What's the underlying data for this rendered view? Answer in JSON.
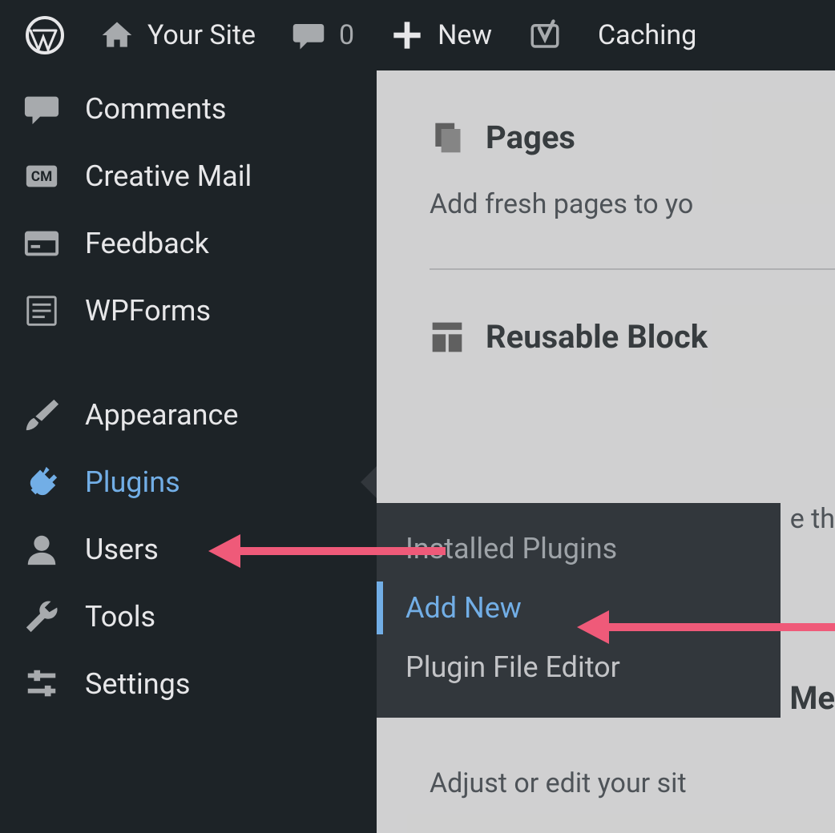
{
  "adminbar": {
    "site_name": "Your Site",
    "comment_count": "0",
    "new_label": "New",
    "caching_label": "Caching"
  },
  "sidebar": {
    "comments": "Comments",
    "creative_mail": "Creative Mail",
    "feedback": "Feedback",
    "wpforms": "WPForms",
    "appearance": "Appearance",
    "plugins": "Plugins",
    "users": "Users",
    "tools": "Tools",
    "settings": "Settings"
  },
  "submenu": {
    "installed": "Installed Plugins",
    "add_new": "Add New",
    "file_editor": "Plugin File Editor"
  },
  "content": {
    "pages_heading": "Pages",
    "pages_text": "Add fresh pages to yo",
    "blocks_heading": "Reusable Block",
    "blocks_text_fragment": "e th",
    "menus_fragment": "Me",
    "adjust_text": "Adjust or edit your sit"
  }
}
